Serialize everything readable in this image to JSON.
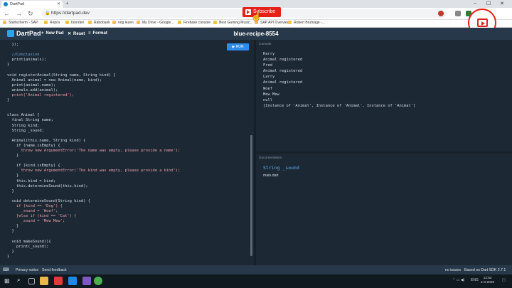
{
  "browser": {
    "tab_title": "DartPad",
    "new_tab": "+",
    "url": "https://dartpad.dev",
    "bookmarks": [
      "Startscherm - SAP...",
      "Repos",
      "boorden",
      "Rabobank",
      "nog lezen",
      "My Drive - Google...",
      "Firebase console",
      "Best Gaming Music...",
      "SAP API Overview",
      "Robert Brumage -..."
    ]
  },
  "overlay": {
    "subscribe_label": "Subscribe"
  },
  "dartpad": {
    "app_title": "DartPad",
    "new_pad": "New Pad",
    "reset": "Reset",
    "format": "Format",
    "pad_name": "blue-recipe-8554",
    "run": "RUN"
  },
  "editor": {
    "lines": [
      "  });",
      "",
      "  //Conclusion",
      "  print(animals);",
      "}",
      "",
      "void registerAnimal(String name, String kind) {",
      "  Animal animal = new Animal(name, kind);",
      "  print(animal.name);",
      "  animals.add(animal);",
      "  print('Animal registered');",
      "}",
      "",
      "",
      "class Animal {",
      "  final String name;",
      "  String kind;",
      "  String _sound;",
      "",
      "  Animal(this.name, String kind) {",
      "    if (name.isEmpty) {",
      "      throw new ArgumentError('The name was empty, please provide a name');",
      "    }",
      "",
      "    if (kind.isEmpty) {",
      "      throw new ArgumentError('The kind was empty, please provide a kind');",
      "    }",
      "    this.kind = kind;",
      "    this.determineSound(this.kind);",
      "  }",
      "",
      "  void determineSound(String kind) {",
      "    if (kind == 'Dog') {",
      "      _sound = 'Woef';",
      "    }else if (kind == 'Cat') {",
      "      _sound = 'Mew Mew';",
      "    }",
      "  }",
      "",
      "  void makeSound(){",
      "    print(_sound);",
      "  }",
      "}"
    ]
  },
  "console": {
    "title": "Console",
    "lines": [
      "Harry",
      "Animal registered",
      "Fred",
      "Animal registered",
      "Larry",
      "Animal registered",
      "Woef",
      "Mew Mew",
      "null",
      "[Instance of 'Animal', Instance of 'Animal', Instance of 'Animal']"
    ]
  },
  "documentation": {
    "title": "Documentation",
    "signature": "String _sound",
    "file": "main.dart"
  },
  "footer": {
    "privacy": "Privacy notice",
    "feedback": "Send feedback",
    "issues": "no issues",
    "sdk": "Based on Dart SDK 2.7.1"
  },
  "taskbar": {
    "time": "12:52",
    "date": "2-3-2020",
    "lang": "ENG"
  }
}
